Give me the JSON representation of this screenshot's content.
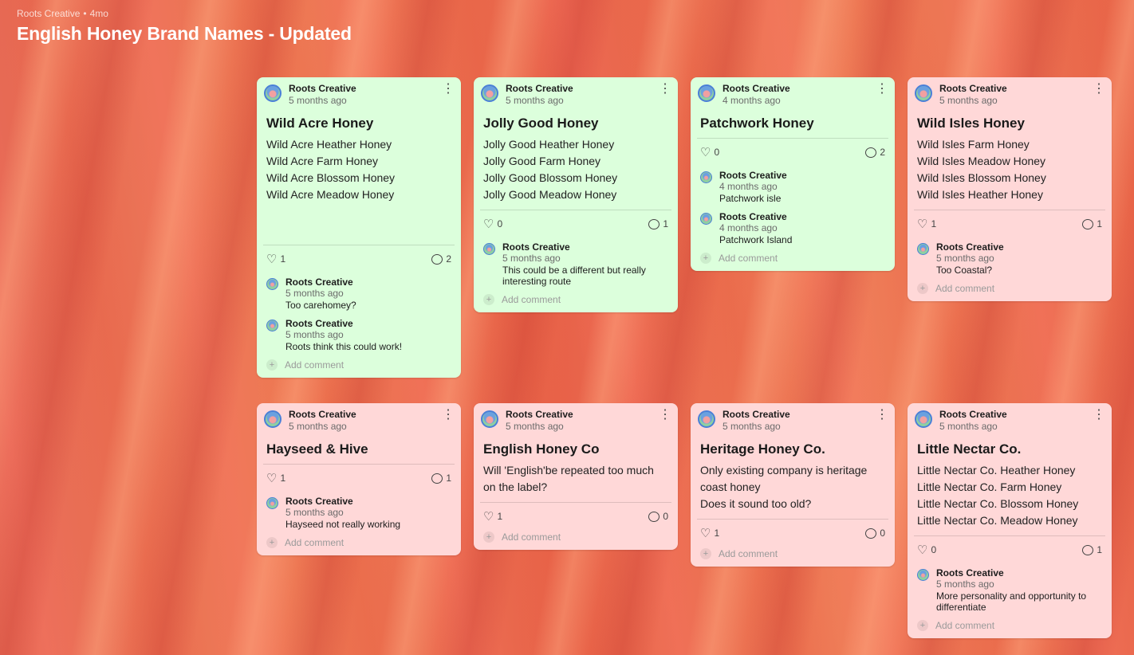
{
  "header": {
    "meta_author": "Roots Creative",
    "meta_separator": "•",
    "meta_age": "4mo",
    "title": "English Honey Brand Names - Updated"
  },
  "add_comment_label": "Add comment",
  "cards": [
    {
      "author": "Roots Creative",
      "time": "5 months ago",
      "color": "#dcffdc",
      "title": "Wild Acre Honey",
      "lines": [
        "Wild Acre Heather Honey",
        "Wild Acre Farm Honey",
        "Wild Acre Blossom Honey",
        "Wild Acre Meadow Honey"
      ],
      "likes": "1",
      "comments_count": "2",
      "comments": [
        {
          "author": "Roots Creative",
          "time": "5 months ago",
          "text": "Too carehomey?"
        },
        {
          "author": "Roots Creative",
          "time": "5 months ago",
          "text": "Roots think this could work!"
        }
      ]
    },
    {
      "author": "Roots Creative",
      "time": "5 months ago",
      "color": "#dcffdc",
      "title": "Jolly Good Honey",
      "lines": [
        "Jolly Good Heather Honey",
        "Jolly Good Farm Honey",
        "Jolly Good Blossom Honey",
        "Jolly Good Meadow Honey"
      ],
      "likes": "0",
      "comments_count": "1",
      "comments": [
        {
          "author": "Roots Creative",
          "time": "5 months ago",
          "text": "This could be a different but really interesting route"
        }
      ]
    },
    {
      "author": "Roots Creative",
      "time": "4 months ago",
      "color": "#dcffdc",
      "title": "Patchwork Honey",
      "lines": [],
      "likes": "0",
      "comments_count": "2",
      "comments": [
        {
          "author": "Roots Creative",
          "time": "4 months ago",
          "text": "Patchwork isle"
        },
        {
          "author": "Roots Creative",
          "time": "4 months ago",
          "text": "Patchwork Island"
        }
      ]
    },
    {
      "author": "Roots Creative",
      "time": "5 months ago",
      "color": "#ffd8d8",
      "title": "Wild Isles Honey",
      "lines": [
        "Wild Isles Farm Honey",
        "Wild Isles Meadow Honey",
        "Wild Isles Blossom Honey",
        "Wild Isles Heather Honey"
      ],
      "likes": "1",
      "comments_count": "1",
      "comments": [
        {
          "author": "Roots Creative",
          "time": "5 months ago",
          "text": "Too Coastal?"
        }
      ]
    },
    {
      "author": "Roots Creative",
      "time": "5 months ago",
      "color": "#ffd8d8",
      "title": "Hayseed & Hive",
      "lines": [],
      "likes": "1",
      "comments_count": "1",
      "comments": [
        {
          "author": "Roots Creative",
          "time": "5 months ago",
          "text": "Hayseed not really working"
        }
      ]
    },
    {
      "author": "Roots Creative",
      "time": "5 months ago",
      "color": "#ffd8d8",
      "title": "English Honey Co",
      "lines": [
        "Will 'English'be repeated too much on the label?"
      ],
      "likes": "1",
      "comments_count": "0",
      "comments": []
    },
    {
      "author": "Roots Creative",
      "time": "5 months ago",
      "color": "#ffd8d8",
      "title": "Heritage Honey Co.",
      "lines": [
        "Only existing company is heritage coast honey",
        "Does it sound too old?"
      ],
      "likes": "1",
      "comments_count": "0",
      "comments": []
    },
    {
      "author": "Roots Creative",
      "time": "5 months ago",
      "color": "#ffd8d8",
      "title": "Little Nectar Co.",
      "lines": [
        "Little Nectar Co. Heather Honey",
        "Little Nectar Co. Farm Honey",
        "Little Nectar Co. Blossom Honey",
        "Little Nectar Co. Meadow Honey"
      ],
      "likes": "0",
      "comments_count": "1",
      "comments": [
        {
          "author": "Roots Creative",
          "time": "5 months ago",
          "text": "More personality and opportunity to differentiate"
        }
      ]
    }
  ]
}
